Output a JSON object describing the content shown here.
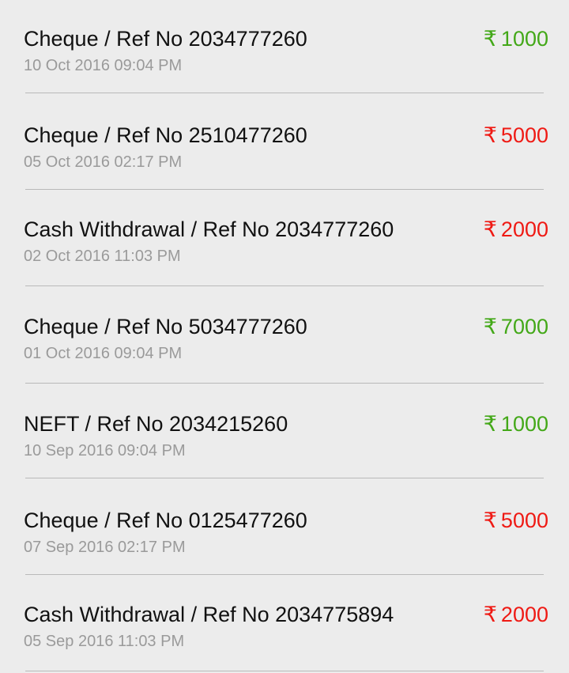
{
  "colors": {
    "credit": "#43a818",
    "debit": "#ef1a14",
    "background": "#ececec",
    "divider": "#b9b9b9"
  },
  "currency_symbol": "₹",
  "transactions": [
    {
      "description": "Cheque / Ref No 2034777260",
      "date": "10 Oct 2016 09:04 PM",
      "amount": "1000",
      "type": "credit"
    },
    {
      "description": "Cheque / Ref No 2510477260",
      "date": "05 Oct 2016 02:17 PM",
      "amount": "5000",
      "type": "debit"
    },
    {
      "description": "Cash Withdrawal / Ref No 2034777260",
      "date": "02 Oct 2016 11:03 PM",
      "amount": "2000",
      "type": "debit"
    },
    {
      "description": "Cheque / Ref No 5034777260",
      "date": "01 Oct 2016 09:04 PM",
      "amount": "7000",
      "type": "credit"
    },
    {
      "description": "NEFT / Ref No 2034215260",
      "date": "10 Sep 2016 09:04 PM",
      "amount": "1000",
      "type": "credit"
    },
    {
      "description": "Cheque / Ref No 0125477260",
      "date": "07 Sep 2016 02:17 PM",
      "amount": "5000",
      "type": "debit"
    },
    {
      "description": "Cash Withdrawal / Ref No 2034775894",
      "date": "05 Sep 2016 11:03 PM",
      "amount": "2000",
      "type": "debit"
    }
  ]
}
